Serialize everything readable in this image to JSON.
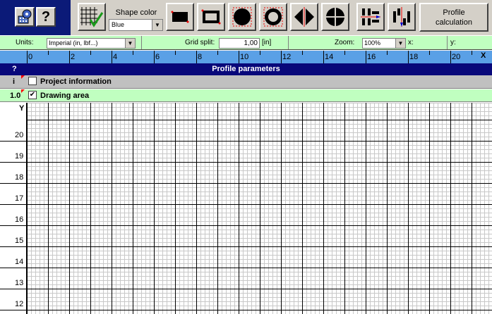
{
  "toolbar": {
    "help_label": "?",
    "shape_color_label": "Shape color",
    "shape_color_value": "Blue",
    "profile_calc_line1": "Profile",
    "profile_calc_line2": "calculation",
    "tools": [
      {
        "name": "grid-toggle-icon"
      },
      {
        "name": "filled-rectangle-icon"
      },
      {
        "name": "hollow-rectangle-icon"
      },
      {
        "name": "filled-circle-icon"
      },
      {
        "name": "hollow-circle-icon"
      },
      {
        "name": "mirror-horizontal-icon"
      },
      {
        "name": "mirror-quad-icon"
      },
      {
        "name": "align-horizontal-icon"
      },
      {
        "name": "align-vertical-icon"
      }
    ]
  },
  "settings": {
    "units_label": "Units:",
    "units_value": "Imperial (in, lbf...)",
    "grid_split_label": "Grid split:",
    "grid_split_value": "1,00",
    "grid_split_unit": "[in]",
    "zoom_label": "Zoom:",
    "zoom_value": "100%",
    "x_coord_label": "x:",
    "y_coord_label": "y:"
  },
  "ruler": {
    "x_axis_label": "X",
    "y_axis_label": "Y",
    "x_labels": [
      "0",
      "2",
      "4",
      "6",
      "8",
      "10",
      "12",
      "14",
      "16",
      "18",
      "20"
    ],
    "y_labels": [
      "20",
      "19",
      "18",
      "17",
      "16",
      "15",
      "14",
      "13",
      "12"
    ]
  },
  "sections": {
    "profile_header_q": "?",
    "profile_header": "Profile parameters",
    "project_index": "i",
    "project_label": "Project information",
    "project_checked": false,
    "drawing_index": "1.0",
    "drawing_label": "Drawing area",
    "drawing_checked": true,
    "check_mark": "✔"
  },
  "colors": {
    "toolbar_bg": "#d4d0c8",
    "left_panel_bg": "#0b1a78",
    "settings_bg": "#c0ffc0",
    "ruler_bg": "#5aa0e6",
    "header_bg": "#08087a",
    "grid_minor": "#c8c8c8",
    "grid_major": "#000000"
  }
}
